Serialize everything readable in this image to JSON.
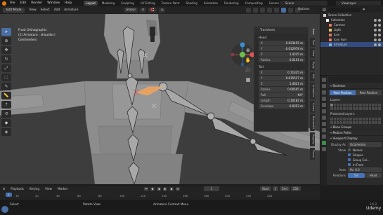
{
  "topbar": {
    "menu": [
      "File",
      "Edit",
      "Render",
      "Window",
      "Help"
    ],
    "workspaces": [
      "Layout",
      "Modeling",
      "Sculpting",
      "UV Editing",
      "Texture Paint",
      "Shading",
      "Animation",
      "Rendering",
      "Compositing",
      "Geome"
    ],
    "active_workspace": "Layout",
    "scene": "Scene",
    "view_layer": "ViewLayer"
  },
  "viewport_header": {
    "mode": "Edit Mode",
    "menus": [
      "View",
      "Select",
      "Add",
      "Armature"
    ],
    "orientation": "Global",
    "options": "Options"
  },
  "overlay": {
    "view_name": "Front Orthographic",
    "object": "(1) Armature : shoulder.l",
    "units": "Centimeters"
  },
  "toolbar": {
    "tools": [
      "select-icon",
      "cursor-icon",
      "move-icon",
      "rotate-icon",
      "scale-icon",
      "transform-icon",
      "annotate-icon",
      "measure-icon",
      "extrude-icon",
      "roll-icon",
      "bone-size-icon",
      "bone-envelope-icon"
    ]
  },
  "transform_panel": {
    "title": "Transform",
    "head_label": "Head:",
    "head": [
      {
        "label": "X",
        "value": "0.023455 m"
      },
      {
        "label": "Y",
        "value": "-0.032978 m"
      },
      {
        "label": "Z",
        "value": "1.4225 m"
      },
      {
        "label": "Radius",
        "value": "0.0101 m"
      }
    ],
    "tail_label": "Tail:",
    "tail": [
      {
        "label": "X",
        "value": "0.11435 m"
      },
      {
        "label": "Y",
        "value": "-0.015527 m"
      },
      {
        "label": "Z",
        "value": "1.4621 m"
      },
      {
        "label": "Radius",
        "value": "0.00505 m"
      },
      {
        "label": "Roll",
        "value": "-64°"
      },
      {
        "label": "Length",
        "value": "0.10182 m"
      },
      {
        "label": "Envelope",
        "value": "0.0253 m"
      }
    ]
  },
  "side_tabs": [
    "Item",
    "Tool",
    "View",
    "Rigify",
    "Edit",
    "Animation",
    "Create",
    "BlenderKit",
    "Rigging",
    "Tissue"
  ],
  "outliner": {
    "rows": [
      {
        "label": "Scene Collection",
        "icon_color": "#cccccc",
        "selected": false
      },
      {
        "label": "Collection",
        "icon_color": "#ffffff",
        "selected": false
      },
      {
        "label": "Camera",
        "icon_color": "#e07a5f",
        "selected": false
      },
      {
        "label": "Light",
        "icon_color": "#e9c46a",
        "selected": false
      },
      {
        "label": "Icon",
        "icon_color": "#e07a5f",
        "selected": false
      },
      {
        "label": "Icon Fuer",
        "icon_color": "#e07a5f",
        "selected": false
      },
      {
        "label": "Armature",
        "icon_color": "#7fb3d5",
        "selected": true
      }
    ]
  },
  "properties": {
    "skeleton_header": "Skeleton",
    "pose_position": "Pose Position",
    "rest_position": "Rest Position",
    "layers_label": "Layers:",
    "protected_label": "Protected Layers:",
    "bone_groups": "Bone Groups",
    "motion_paths": "Motion Paths",
    "viewport_display": "Viewport Display",
    "display_as_label": "Display As",
    "display_as": "Octahedral",
    "show_label": "Show",
    "show_items": [
      {
        "label": "Names",
        "on": false
      },
      {
        "label": "Shapes",
        "on": true
      },
      {
        "label": "Group Col...",
        "on": true
      },
      {
        "label": "In Front",
        "on": true
      }
    ],
    "axes_label": "Axes",
    "axes_value": "Po: 0.0",
    "relations_label": "Relations",
    "relations": [
      "Tail",
      "Head"
    ]
  },
  "timeline": {
    "menus": [
      "Playback",
      "Keying",
      "View",
      "Marker"
    ],
    "current_frame": "1",
    "start_label": "Start",
    "start": "1",
    "end_label": "End",
    "end": "250",
    "ruler": [
      "1",
      "10",
      "20",
      "40",
      "60",
      "80",
      "100",
      "120",
      "140",
      "160",
      "180",
      "200",
      "220",
      "240"
    ]
  },
  "statusbar": {
    "left": "Select",
    "middle": "Rotate View",
    "right": "Armature Context Menu",
    "version": "3.6.2",
    "brand": "Udemy"
  }
}
